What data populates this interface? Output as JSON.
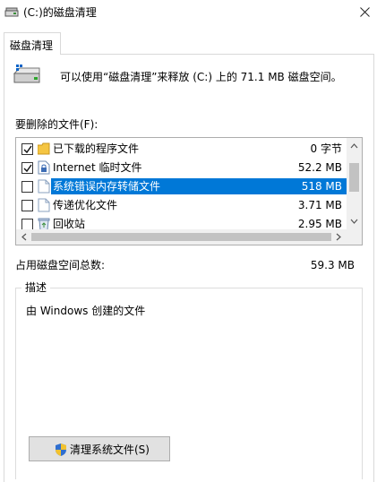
{
  "window": {
    "title": "(C:)的磁盘清理"
  },
  "tabs": [
    {
      "label": "磁盘清理"
    }
  ],
  "header": {
    "info_text": "可以使用“磁盘清理”来释放  (C:) 上的 71.1 MB 磁盘空间。",
    "drive_icon": "drive-icon"
  },
  "files_section": {
    "label": "要删除的文件(F):",
    "items": [
      {
        "name": "已下载的程序文件",
        "size": "0 字节",
        "checked": true,
        "icon": "folder-icon",
        "selected": false
      },
      {
        "name": "Internet 临时文件",
        "size": "52.2 MB",
        "checked": true,
        "icon": "lock-file-icon",
        "selected": false
      },
      {
        "name": "系统错误内存转储文件",
        "size": "518 MB",
        "checked": false,
        "icon": "file-icon",
        "selected": true
      },
      {
        "name": "传递优化文件",
        "size": "3.71 MB",
        "checked": false,
        "icon": "file-icon",
        "selected": false
      },
      {
        "name": "回收站",
        "size": "2.95 MB",
        "checked": false,
        "icon": "recycle-bin-icon",
        "selected": false
      }
    ]
  },
  "total": {
    "label": "占用磁盘空间总数:",
    "value": "59.3 MB"
  },
  "description": {
    "legend": "描述",
    "text": "由 Windows 创建的文件"
  },
  "buttons": {
    "clean_system_files": "清理系统文件(S)"
  },
  "colors": {
    "selection": "#0078d7",
    "button_bg": "#e1e1e1",
    "border": "#adadad"
  }
}
